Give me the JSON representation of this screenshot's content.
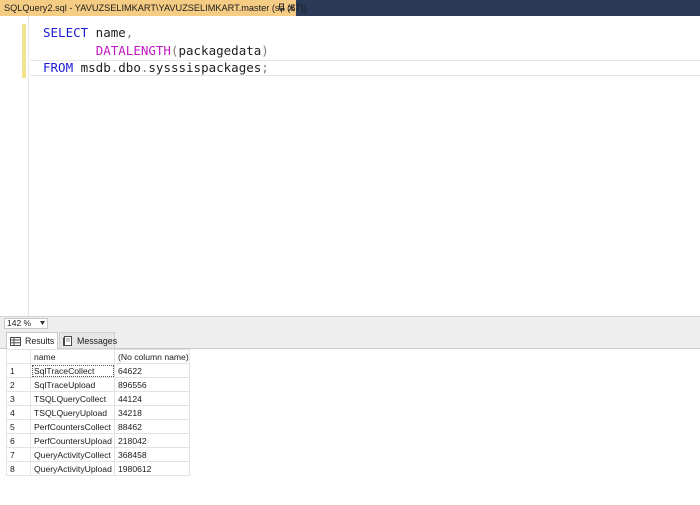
{
  "document_tab": {
    "title": "SQLQuery2.sql - YAVUZSELIMKART\\YAVUZSELIMKART.master (sa (57))"
  },
  "editor": {
    "lines": [
      [
        {
          "t": "SELECT",
          "k": "kw"
        },
        {
          "t": " name",
          "k": "tx"
        },
        {
          "t": ",",
          "k": "pl"
        }
      ],
      [
        {
          "t": "       ",
          "k": "tx"
        },
        {
          "t": "DATALENGTH",
          "k": "fn"
        },
        {
          "t": "(",
          "k": "pl"
        },
        {
          "t": "packagedata",
          "k": "tx"
        },
        {
          "t": ")",
          "k": "pl"
        }
      ],
      [
        {
          "t": "FROM",
          "k": "kw"
        },
        {
          "t": " msdb",
          "k": "tx"
        },
        {
          "t": ".",
          "k": "pl"
        },
        {
          "t": "dbo",
          "k": "tx"
        },
        {
          "t": ".",
          "k": "pl"
        },
        {
          "t": "sysssispackages",
          "k": "tx"
        },
        {
          "t": ";",
          "k": "pl"
        }
      ]
    ]
  },
  "zoom": {
    "value": "142 %"
  },
  "results_tabs": {
    "results_label": "Results",
    "messages_label": "Messages"
  },
  "grid": {
    "columns": [
      "",
      "name",
      "(No column name)"
    ],
    "rows": [
      [
        "1",
        "SqlTraceCollect",
        "64622"
      ],
      [
        "2",
        "SqlTraceUpload",
        "896556"
      ],
      [
        "3",
        "TSQLQueryCollect",
        "44124"
      ],
      [
        "4",
        "TSQLQueryUpload",
        "34218"
      ],
      [
        "5",
        "PerfCountersCollect",
        "88462"
      ],
      [
        "6",
        "PerfCountersUpload",
        "218042"
      ],
      [
        "7",
        "QueryActivityCollect",
        "368458"
      ],
      [
        "8",
        "QueryActivityUpload",
        "1980612"
      ]
    ],
    "selected_cell": "SqlTraceCollect"
  },
  "colors": {
    "keyword": "#1c1cd4",
    "function": "#c218c2",
    "tab_active": "#f5cc84",
    "tabstrip": "#2b3a56"
  },
  "icons": [
    "pin-icon",
    "close-icon",
    "chevron-down-icon",
    "results-grid-icon",
    "messages-icon"
  ]
}
